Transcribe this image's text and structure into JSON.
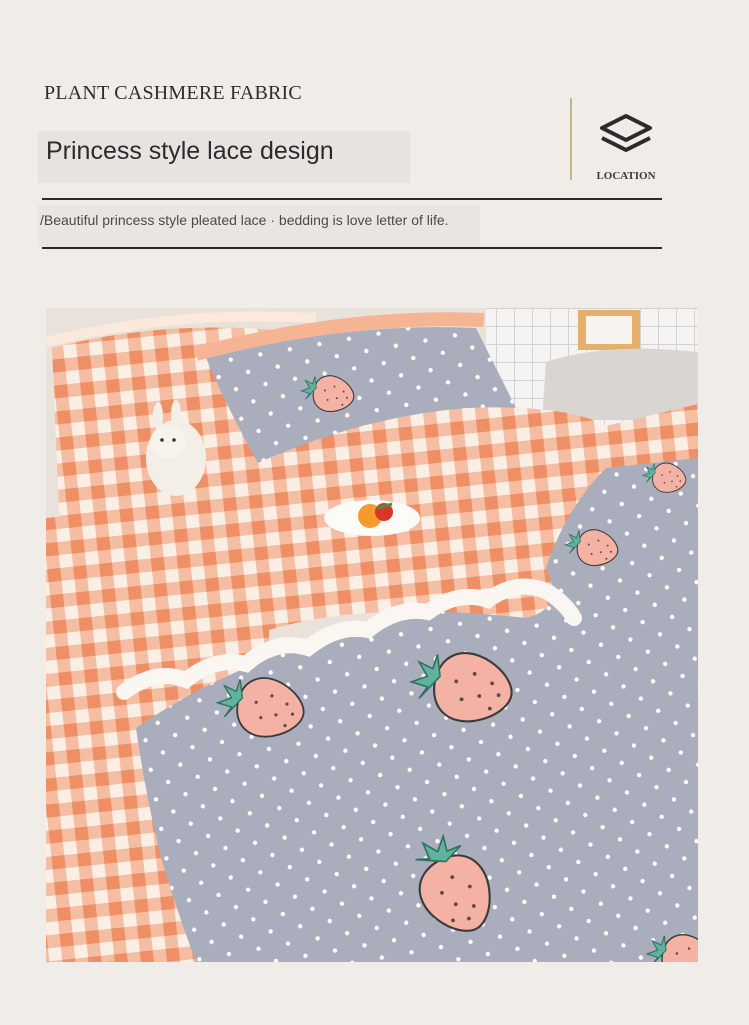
{
  "header": {
    "brand": "PLANT CASHMERE FABRIC",
    "subtitle": "Princess style lace design",
    "location_label": "LOCATION",
    "location_icon": "layers-icon",
    "description": "/Beautiful princess style pleated lace · bedding is love letter of life."
  },
  "photo": {
    "subject": "bedding-set-photo",
    "colors": {
      "gingham": "#f2a27c",
      "cover": "#a9adbc",
      "strawberry": "#f4b2a4",
      "leaf": "#5fb39c"
    }
  }
}
